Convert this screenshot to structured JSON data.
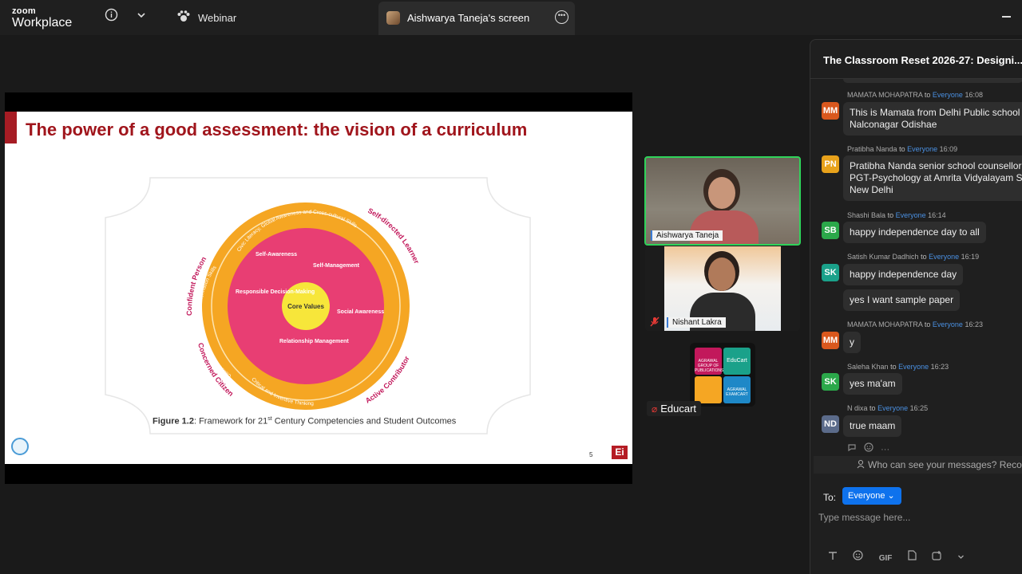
{
  "topbar": {
    "brand_line1": "zoom",
    "brand_line2": "Workplace",
    "info_icon": "info-icon",
    "chevron_icon": "chevron-down-icon",
    "webinar_label": "Webinar",
    "active_tab_label": "Aishwarya Taneja's screen",
    "more_icon": "more-icon"
  },
  "slide": {
    "title": "The power of a good assessment: the vision of a curriculum",
    "figure": {
      "outer_labels": [
        "Confident Person",
        "Self-directed Learner",
        "Concerned Citizen",
        "Active Contributor"
      ],
      "ring_top": "Civic Literacy, Global Awareness and Cross-cultural Skills",
      "ring_left": "Communication, Collaboration and Information Skills",
      "ring_bottom": "Critical and Inventive Thinking",
      "inner_labels": [
        "Self-Awareness",
        "Self-Management",
        "Responsible Decision-Making",
        "Social Awareness",
        "Relationship Management"
      ],
      "core": "Core Values"
    },
    "caption_bold": "Figure 1.2",
    "caption_rest": ": Framework for 21",
    "caption_sup": "st",
    "caption_end": " Century Competencies and Student Outcomes",
    "page_number": "5",
    "logo_text": "Ei"
  },
  "participants": [
    {
      "name": "Aishwarya Taneja"
    },
    {
      "name": "Nishant Lakra"
    },
    {
      "name": "Educart"
    }
  ],
  "educart_tiles": [
    "AGRAWAL GROUP OF PUBLICATIONS",
    "EduCart",
    "AGRAWAL EXAMCART"
  ],
  "chat": {
    "title": "The Classroom Reset 2026-27: Designi...",
    "messages": [
      {
        "from": "MAMATA MOHAPATRA",
        "to": "to",
        "ev": "Everyone",
        "time": "16:08",
        "initials": "MM",
        "color": "#d9581e",
        "lines": [
          "This is Mamata from Delhi Public school",
          "Nalconagar Odishae"
        ]
      },
      {
        "from": "Pratibha Nanda",
        "to": "to",
        "ev": "Everyone",
        "time": "16:09",
        "initials": "PN",
        "color": "#e8a21b",
        "lines": [
          "Pratibha Nanda senior school counsellor",
          "PGT-Psychology at Amrita Vidyalayam Sa",
          "New Delhi"
        ]
      },
      {
        "from": "Shashi Bala",
        "to": "to",
        "ev": "Everyone",
        "time": "16:14",
        "initials": "SB",
        "color": "#2ba84a",
        "lines": [
          "happy independence day to all"
        ]
      },
      {
        "from": "Satish Kumar Dadhich",
        "to": "to",
        "ev": "Everyone",
        "time": "16:19",
        "initials": "SK",
        "color": "#1aa18a",
        "lines": [
          "happy independence day"
        ],
        "extra": "yes I want sample paper"
      },
      {
        "from": "MAMATA MOHAPATRA",
        "to": "to",
        "ev": "Everyone",
        "time": "16:23",
        "initials": "MM",
        "color": "#d9581e",
        "lines": [
          "y"
        ]
      },
      {
        "from": "Saleha Khan",
        "to": "to",
        "ev": "Everyone",
        "time": "16:23",
        "initials": "SK",
        "color": "#2ba84a",
        "lines": [
          "yes ma'am"
        ]
      },
      {
        "from": "N dixa",
        "to": "to",
        "ev": "Everyone",
        "time": "16:25",
        "initials": "ND",
        "color": "#5b6b8a",
        "lines": [
          "true maam"
        ]
      }
    ],
    "privacy_text": "Who can see your messages? Recor",
    "to_label": "To:",
    "to_value": "Everyone",
    "input_placeholder": "Type message here...",
    "gif_label": "GIF"
  }
}
